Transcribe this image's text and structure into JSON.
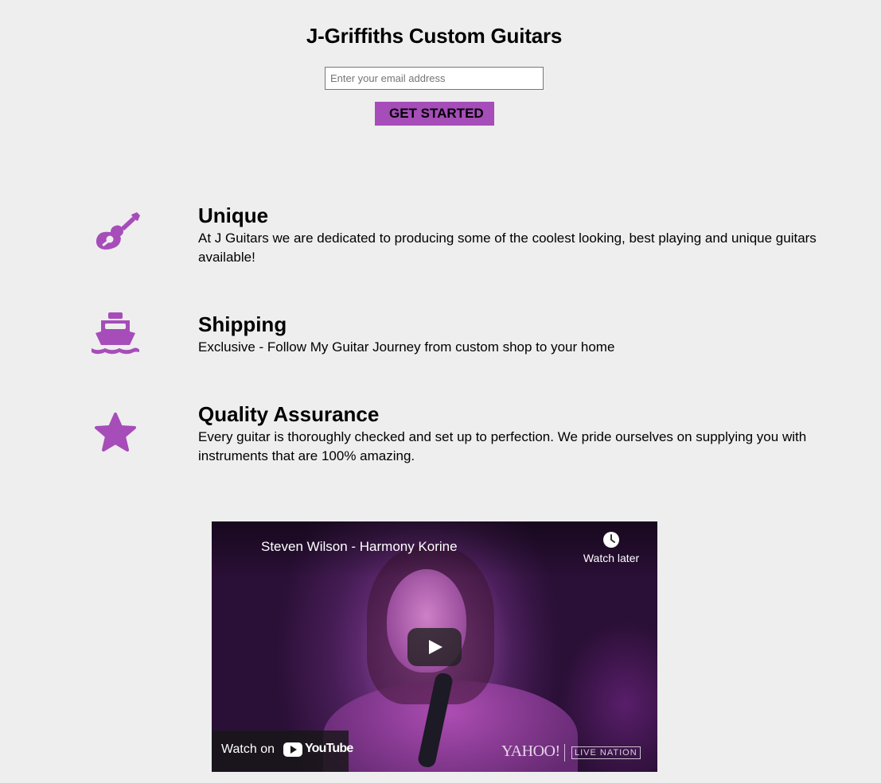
{
  "header": {
    "title": "J-Griffiths Custom Guitars",
    "email_placeholder": "Enter your email address",
    "cta_label": "GET STARTED"
  },
  "colors": {
    "accent": "#a64db9",
    "background": "#eeeeee"
  },
  "features": [
    {
      "icon": "guitar-icon",
      "title": "Unique",
      "text": "At J Guitars we are dedicated to producing some of the coolest looking, best playing and unique guitars available!"
    },
    {
      "icon": "ship-icon",
      "title": "Shipping",
      "text": "Exclusive - Follow My Guitar Journey from custom shop to your home"
    },
    {
      "icon": "star-icon",
      "title": "Quality Assurance",
      "text": "Every guitar is thoroughly checked and set up to perfection. We pride ourselves on supplying you with instruments that are 100% amazing."
    }
  ],
  "video": {
    "title": "Steven Wilson - Harmony Korine",
    "watch_later_label": "Watch later",
    "watch_on_label": "Watch on",
    "youtube_label": "YouTube",
    "brand_yahoo": "YAHOO!",
    "brand_live_nation": "LIVE NATION"
  }
}
